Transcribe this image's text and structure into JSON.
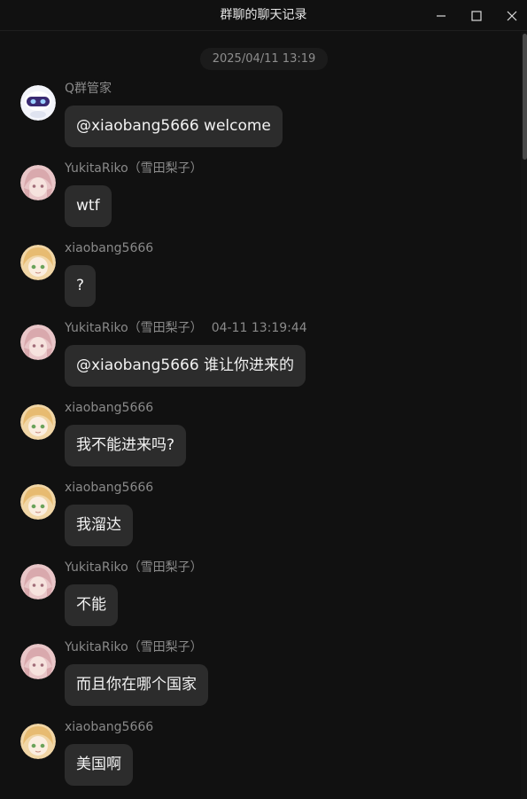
{
  "window": {
    "title": "群聊的聊天记录"
  },
  "chat": {
    "timestamp": "2025/04/11 13:19",
    "messages": [
      {
        "sender": "Q群管家",
        "time": "",
        "text": "@xiaobang5666 welcome",
        "avatar": "bot-avatar"
      },
      {
        "sender": "YukitaRiko（雪田梨子）",
        "time": "",
        "text": "wtf",
        "avatar": "pink-hair-avatar"
      },
      {
        "sender": "xiaobang5666",
        "time": "",
        "text": "?",
        "avatar": "blonde-hair-avatar"
      },
      {
        "sender": "YukitaRiko（雪田梨子）",
        "time": "04-11 13:19:44",
        "text": "@xiaobang5666 谁让你进来的",
        "avatar": "pink-hair-avatar"
      },
      {
        "sender": "xiaobang5666",
        "time": "",
        "text": "我不能进来吗?",
        "avatar": "blonde-hair-avatar"
      },
      {
        "sender": "xiaobang5666",
        "time": "",
        "text": "我溜达",
        "avatar": "blonde-hair-avatar"
      },
      {
        "sender": "YukitaRiko（雪田梨子）",
        "time": "",
        "text": "不能",
        "avatar": "pink-hair-avatar"
      },
      {
        "sender": "YukitaRiko（雪田梨子）",
        "time": "",
        "text": "而且你在哪个国家",
        "avatar": "pink-hair-avatar"
      },
      {
        "sender": "xiaobang5666",
        "time": "",
        "text": "美国啊",
        "avatar": "blonde-hair-avatar"
      }
    ]
  },
  "colors": {
    "background": "#111111",
    "bubble": "#2c2c2c",
    "text": "#f2f2f2",
    "meta": "#8a8a8a"
  }
}
